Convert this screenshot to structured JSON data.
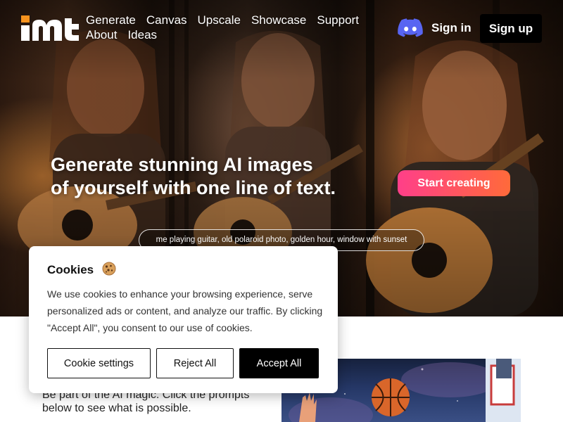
{
  "nav": {
    "links": [
      "Generate",
      "Canvas",
      "Upscale",
      "Showcase",
      "Support",
      "About",
      "Ideas"
    ],
    "sign_in": "Sign in",
    "sign_up": "Sign up"
  },
  "hero": {
    "headline_line1": "Generate stunning AI images",
    "headline_line2": "of yourself with one line of text.",
    "cta": "Start creating",
    "prompt": "me playing guitar, old polaroid photo, golden hour, window with sunset"
  },
  "section": {
    "text": "Be part of the AI magic. Click the prompts below to see what is possible."
  },
  "cookie": {
    "title": "Cookies",
    "body": "We use cookies to enhance your browsing experience, serve personalized ads or content, and analyze our traffic. By clicking \"Accept All\", you consent to our use of cookies.",
    "settings": "Cookie settings",
    "reject": "Reject All",
    "accept": "Accept All"
  },
  "colors": {
    "logo_orange": "#f7931e",
    "cta_start": "#ff3f89",
    "cta_end": "#ff6a3a",
    "discord": "#5865f2"
  },
  "icons": [
    "logo",
    "discord-icon",
    "cookie-icon"
  ]
}
